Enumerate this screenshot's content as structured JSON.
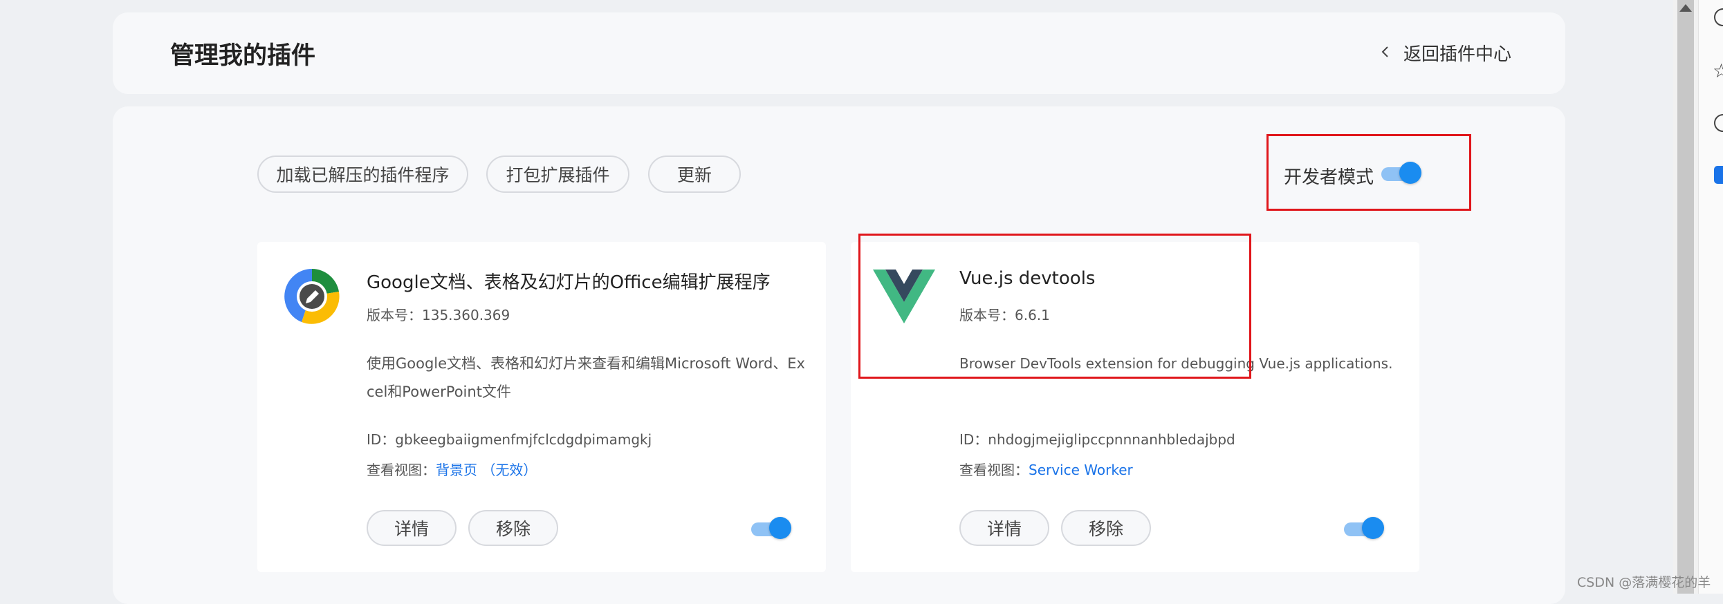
{
  "header": {
    "title": "管理我的插件",
    "back_label": "返回插件中心"
  },
  "toolbar": {
    "load_unpacked": "加载已解压的插件程序",
    "pack_extension": "打包扩展插件",
    "update": "更新",
    "dev_mode_label": "开发者模式",
    "dev_mode_on": true
  },
  "extensions": [
    {
      "name": "Google文档、表格及幻灯片的Office编辑扩展程序",
      "version": "版本号：135.360.369",
      "desc_line1": "使用Google文档、表格和幻灯片来查看和编辑Microsoft Word、Ex",
      "desc_line2": "cel和PowerPoint文件",
      "id": "ID：gbkeegbaiigmenfmjfclcdgdpimamgkj",
      "views_label": "查看视图：",
      "views_link": "背景页 （无效）",
      "details": "详情",
      "remove": "移除",
      "enabled": true,
      "icon": "google-docs-edit-icon"
    },
    {
      "name": "Vue.js devtools",
      "version": "版本号：6.6.1",
      "desc_line1": "Browser DevTools extension for debugging Vue.js applications.",
      "desc_line2": "",
      "id": "ID：nhdogjmejiglipccpnnnanhbledajbpd",
      "views_label": "查看视图：",
      "views_link": "Service Worker",
      "details": "详情",
      "remove": "移除",
      "enabled": true,
      "icon": "vue-logo-icon"
    }
  ],
  "watermark": "CSDN @落满樱花的羊",
  "colors": {
    "accent": "#1a8cf0",
    "highlight_box": "#e0161b",
    "link": "#1a73e8"
  }
}
